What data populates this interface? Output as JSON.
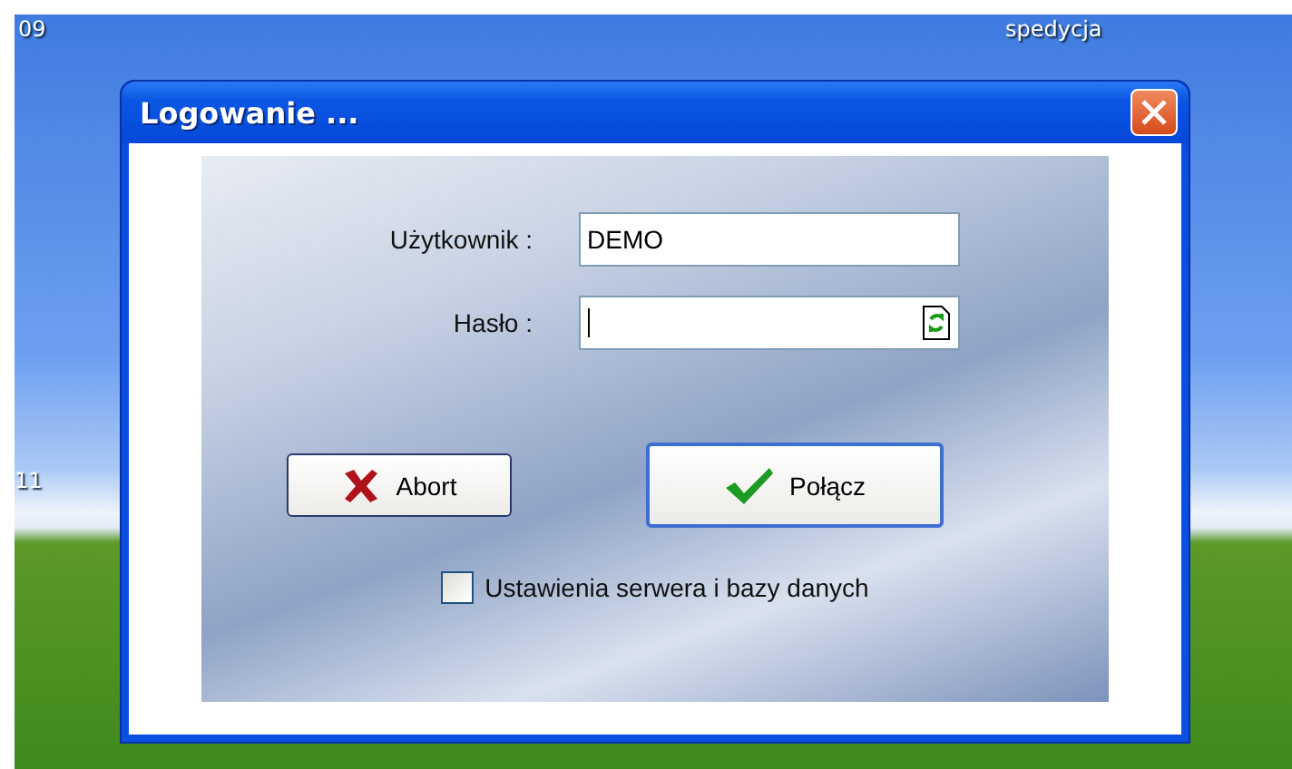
{
  "desktop_labels": [
    {
      "text": "09"
    },
    {
      "text": "spedycja"
    },
    {
      "text": "11"
    }
  ],
  "dialog": {
    "title": "Logowanie ...",
    "fields": [
      {
        "label": "Użytkownik :",
        "value": "DEMO",
        "kind": "text"
      },
      {
        "label": "Hasło :",
        "kind": "password",
        "focused": true
      }
    ],
    "buttons": [
      {
        "label": "Abort",
        "kind": "cancel",
        "default": false
      },
      {
        "label": "Połącz",
        "kind": "confirm",
        "default": true
      }
    ],
    "checkbox": {
      "label": "Ustawienia serwera i bazy danych",
      "checked": false
    }
  }
}
